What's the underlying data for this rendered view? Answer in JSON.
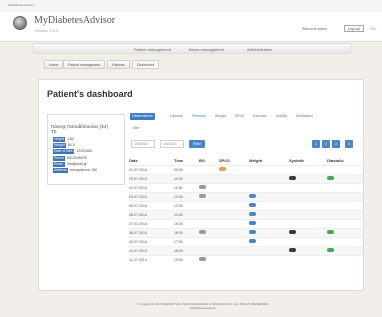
{
  "browser": {
    "tab_label": "MyDiabetesAdvisor"
  },
  "header": {
    "brand": "MyDiabetesAdvisor",
    "version": "Version 1.0.0",
    "welcome": "Welcome admin",
    "logout": "Log out",
    "flag": "En"
  },
  "nav": {
    "items": [
      "Patient management",
      "Ilness management",
      "Administration"
    ]
  },
  "breadcrumb": {
    "items": [
      "Home",
      "Patient management",
      "Patients",
      "Dashboard"
    ]
  },
  "page": {
    "title": "Patient's dashboard"
  },
  "patient": {
    "name": "Γιάννης Παπαδόπουλος (54)",
    "name2": "ΤΣ",
    "fields": [
      {
        "label": "Height",
        "value": "1.82"
      },
      {
        "label": "Weight",
        "value": "84.0"
      },
      {
        "label": "Date of Birth",
        "value": "12/5/1960"
      },
      {
        "label": "Phone",
        "value": "6912345678"
      },
      {
        "label": "Email",
        "value": "info@mail.gr"
      },
      {
        "label": "Address",
        "value": "Ιπποκράτους 150"
      }
    ]
  },
  "tabs": {
    "items": [
      "Observations",
      "Glucose",
      "Pressure",
      "Weight",
      "SPO2",
      "Exercise",
      "Activity",
      "Medication"
    ],
    "more": "Diet"
  },
  "filter": {
    "from": "1/6/2014",
    "to": "1/6/2014",
    "button": "Filter",
    "pages": [
      "1",
      "2",
      "3",
      "4"
    ]
  },
  "table": {
    "columns": [
      "Date",
      "Time",
      "BG",
      "SPO2",
      "Weight",
      "Systolic",
      "Diastolic"
    ],
    "rows": [
      {
        "date": "01-07-2014",
        "time": "09:00",
        "bg": "",
        "spo2": "orange",
        "weight": "",
        "systolic": "",
        "diastolic": ""
      },
      {
        "date": "02-07-2014",
        "time": "10:00",
        "bg": "",
        "spo2": "",
        "weight": "",
        "systolic": "dark",
        "diastolic": "green"
      },
      {
        "date": "03-07-2014",
        "time": "11:00",
        "bg": "gray",
        "spo2": "",
        "weight": "",
        "systolic": "",
        "diastolic": ""
      },
      {
        "date": "04-07-2014",
        "time": "12:00",
        "bg": "gray",
        "spo2": "",
        "weight": "blue",
        "systolic": "",
        "diastolic": ""
      },
      {
        "date": "05-07-2014",
        "time": "13:00",
        "bg": "",
        "spo2": "",
        "weight": "blue",
        "systolic": "",
        "diastolic": ""
      },
      {
        "date": "06-07-2014",
        "time": "14:00",
        "bg": "",
        "spo2": "",
        "weight": "blue",
        "systolic": "",
        "diastolic": ""
      },
      {
        "date": "07-07-2014",
        "time": "15:00",
        "bg": "",
        "spo2": "",
        "weight": "blue",
        "systolic": "",
        "diastolic": ""
      },
      {
        "date": "08-07-2014",
        "time": "16:00",
        "bg": "gray",
        "spo2": "",
        "weight": "blue",
        "systolic": "dark",
        "diastolic": "green"
      },
      {
        "date": "09-07-2014",
        "time": "17:00",
        "bg": "",
        "spo2": "",
        "weight": "blue",
        "systolic": "",
        "diastolic": ""
      },
      {
        "date": "10-07-2014",
        "time": "18:00",
        "bg": "",
        "spo2": "",
        "weight": "",
        "systolic": "dark",
        "diastolic": "green"
      },
      {
        "date": "11-07-2014",
        "time": "19:00",
        "bg": "gray",
        "spo2": "",
        "weight": "",
        "systolic": "",
        "diastolic": ""
      }
    ]
  },
  "footer": {
    "line1": "© Copyright 2014 PERCEPTUAL TECH RESEARCH & TECHNOLOGY. ALL RIGHTS RESERVED",
    "line2": "MyDiabetesAdvisor"
  },
  "colors": {
    "blue": "#4a86c6",
    "green": "#4aa85b",
    "dark": "#3b3b3b",
    "gray": "#9a9a9a",
    "orange": "#f0a030"
  }
}
